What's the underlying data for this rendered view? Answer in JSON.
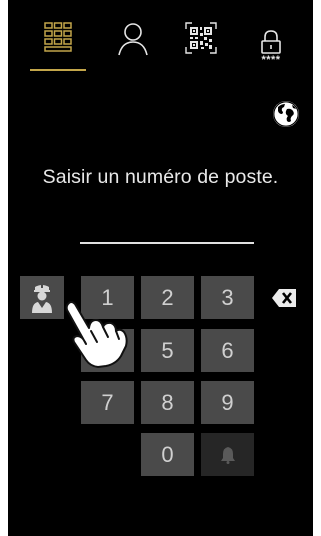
{
  "colors": {
    "accent": "#c3a64a",
    "background": "#000000",
    "key": "#4a4a4a",
    "text": "#e8e8e8"
  },
  "tabs": [
    {
      "icon": "keypad-icon",
      "active": true
    },
    {
      "icon": "person-icon",
      "active": false
    },
    {
      "icon": "qr-code-icon",
      "active": false
    },
    {
      "icon": "lock-icon",
      "active": false,
      "caption": "****"
    }
  ],
  "language_icon": "globe-icon",
  "prompt": "Saisir un numéro de poste.",
  "entry_value": "",
  "keypad": {
    "concierge_icon": "concierge-icon",
    "backspace_icon": "backspace-icon",
    "bell_icon": "bell-icon",
    "digits": [
      "1",
      "2",
      "3",
      "4",
      "5",
      "6",
      "7",
      "8",
      "9",
      "0"
    ]
  },
  "overlay_icon": "tap-hand-icon"
}
